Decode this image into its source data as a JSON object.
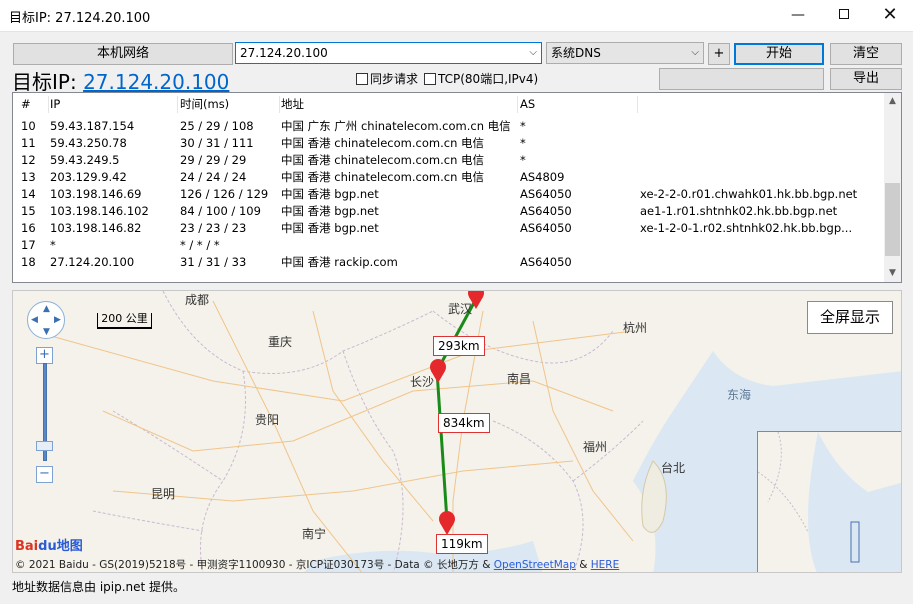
{
  "window": {
    "title": "目标IP: 27.124.20.100",
    "minimize": "—",
    "close": "✕"
  },
  "toolbar": {
    "local_network_btn": "本机网络",
    "ip_input_value": "27.124.20.100",
    "dns_select": "系统DNS",
    "plus_btn": "+",
    "start_btn": "开始",
    "clear_btn": "清空",
    "export_btn": "导出"
  },
  "target": {
    "prefix": "目标IP: ",
    "ip": "27.124.20.100"
  },
  "options": {
    "sync_request": "同步请求",
    "tcp": "TCP(80端口,IPv4)"
  },
  "table": {
    "headers": [
      "#",
      "IP",
      "时间(ms)",
      "地址",
      "AS",
      ""
    ],
    "rows": [
      [
        "10",
        "59.43.187.154",
        "25 / 29 / 108",
        "中国 广东 广州 chinatelecom.com.cn 电信",
        "*",
        ""
      ],
      [
        "11",
        "59.43.250.78",
        "30 / 31 / 111",
        "中国 香港 chinatelecom.com.cn 电信",
        "*",
        ""
      ],
      [
        "12",
        "59.43.249.5",
        "29 / 29 / 29",
        "中国 香港 chinatelecom.com.cn 电信",
        "*",
        ""
      ],
      [
        "13",
        "203.129.9.42",
        "24 / 24 / 24",
        "中国 香港 chinatelecom.com.cn 电信",
        "AS4809",
        ""
      ],
      [
        "14",
        "103.198.146.69",
        "126 / 126 / 129",
        "中国 香港 bgp.net",
        "AS64050",
        "xe-2-2-0.r01.chwahk01.hk.bb.bgp.net"
      ],
      [
        "15",
        "103.198.146.102",
        "84 / 100 / 109",
        "中国 香港 bgp.net",
        "AS64050",
        "ae1-1.r01.shtnhk02.hk.bb.bgp.net"
      ],
      [
        "16",
        "103.198.146.82",
        "23 / 23 / 23",
        "中国 香港 bgp.net",
        "AS64050",
        "xe-1-2-0-1.r02.shtnhk02.hk.bb.bgp..."
      ],
      [
        "17",
        "*",
        "* / * / *",
        "",
        "",
        ""
      ],
      [
        "18",
        "27.124.20.100",
        "31 / 31 / 33",
        "中国 香港 rackip.com",
        "AS64050",
        ""
      ]
    ]
  },
  "map": {
    "fullscreen_btn": "全屏显示",
    "scale": "200 公里",
    "cities": [
      "成都",
      "武汉",
      "杭州",
      "重庆",
      "长沙",
      "南昌",
      "贵阳",
      "福州",
      "台北",
      "昆明",
      "南宁"
    ],
    "sea": "东海",
    "distances": [
      "293km",
      "834km",
      "119km"
    ],
    "zoom_in": "+",
    "zoom_out": "−",
    "logo_a": "Bai",
    "logo_b": "du地图",
    "copyright_text": "© 2021 Baidu - GS(2019)5218号 - 甲测资字1100930 - 京ICP证030173号 - Data © 长地万方 & ",
    "copyright_link1": "OpenStreetMap",
    "copyright_amp": " & ",
    "copyright_link2": "HERE"
  },
  "status": "地址数据信息由 ipip.net 提供。"
}
